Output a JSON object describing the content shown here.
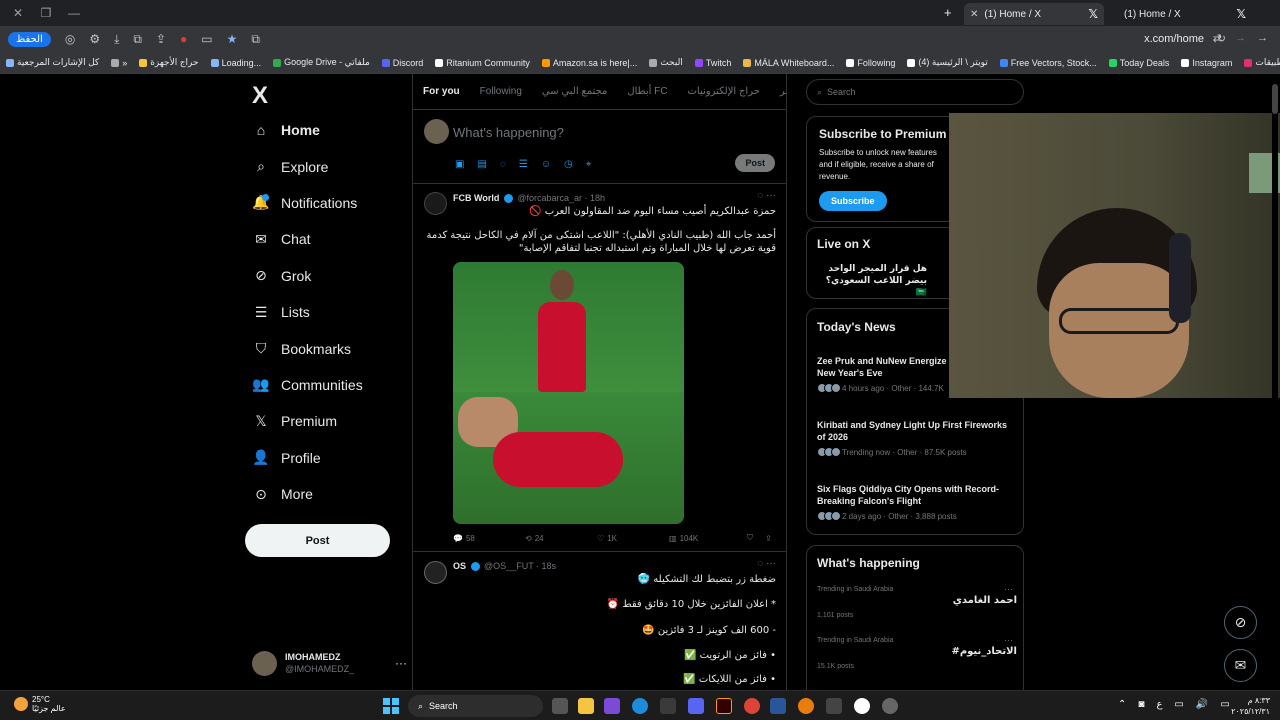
{
  "browser": {
    "tabs": [
      {
        "title": "(1) Home / X"
      },
      {
        "title": "(1) Home / X"
      }
    ],
    "new_tab": "+",
    "url": "x.com/home",
    "profile_label": "الحفظ",
    "bookmarks": [
      "كل الإشارات المرجعية",
      "»",
      "حراج الأجهزة",
      "Loading...",
      "Google Drive - ملفاتي",
      "Discord",
      "Ritanium Community",
      "Amazon.sa is here|...",
      "البحث",
      "Twitch",
      "MÁLA Whiteboard...",
      "Following",
      "(4) تويتر \\ الرئيسية",
      "Free Vectors, Stock...",
      "Today Deals",
      "Instagram",
      "التطبيقات"
    ]
  },
  "sidebar": {
    "logo": "X",
    "items": [
      {
        "label": "Home",
        "icon": "home-icon"
      },
      {
        "label": "Explore",
        "icon": "search-icon"
      },
      {
        "label": "Notifications",
        "icon": "bell-icon"
      },
      {
        "label": "Chat",
        "icon": "mail-icon"
      },
      {
        "label": "Grok",
        "icon": "grok-icon"
      },
      {
        "label": "Lists",
        "icon": "list-icon"
      },
      {
        "label": "Bookmarks",
        "icon": "bookmark-icon"
      },
      {
        "label": "Communities",
        "icon": "people-icon"
      },
      {
        "label": "Premium",
        "icon": "x-icon"
      },
      {
        "label": "Profile",
        "icon": "person-icon"
      },
      {
        "label": "More",
        "icon": "more-circle-icon"
      }
    ],
    "post_label": "Post",
    "account": {
      "name": "IMOHAMEDZ",
      "handle": "@IMOHAMEDZ_",
      "more": "···"
    }
  },
  "feed": {
    "tabs": [
      "For you",
      "Following",
      "مجتمع البي سي",
      "أبطال FC",
      "حراج الإلكترونيات",
      "أساطير"
    ],
    "compose_placeholder": "What's happening?",
    "compose_post": "Post",
    "tweets": [
      {
        "name": "FCB World",
        "handle": "@forcabarca_ar · 18h",
        "lines": [
          "حمزة عبدالكريم أصيب مساء اليوم ضد المقاولون العرب 🚫",
          "أحمد جاب الله (طبيب النادي الأهلي): \"اللاعب اشتكى من آلام في الكاحل نتيجة كدمة",
          "قوية تعرض لها خلال المباراة وتم استبداله تجنبا لتفاقم الإصابة\""
        ],
        "replies": "58",
        "reposts": "24",
        "likes": "1K",
        "views": "104K"
      },
      {
        "name": "OS",
        "handle": "@OS__FUT · 18s",
        "lines": [
          "ضغطة زر بتضبط لك التشكيله 🥶",
          "* اعلان الفائزين خلال 10 دقائق فقط ⏰",
          "- 600 الف كوينز لـ 3 فائزين 🤩",
          "• فائز من الرتويت ✅",
          "• فائز من اللايكات ✅"
        ]
      }
    ]
  },
  "right": {
    "search_placeholder": "Search",
    "premium": {
      "title": "Subscribe to Premium",
      "text": "Subscribe to unlock new features and if eligible, receive a share of revenue.",
      "button": "Subscribe"
    },
    "live": {
      "title": "Live on X",
      "item": "هل قرار الميجر الواحد بيضر اللاعب السعودي؟ 🇸🇦"
    },
    "news": {
      "title": "Today's News",
      "items": [
        {
          "title": "Zee Pruk and NuNew Energize CentralWorld's New Year's Eve",
          "meta": "4 hours ago · Other · 144.7K"
        },
        {
          "title": "Kiribati and Sydney Light Up First Fireworks of 2026",
          "meta": "Trending now · Other · 87.5K posts"
        },
        {
          "title": "Six Flags Qiddiya City Opens with Record-Breaking Falcon's Flight",
          "meta": "2 days ago · Other · 3,888 posts"
        }
      ]
    },
    "happening": {
      "title": "What's happening",
      "trends": [
        {
          "location": "Trending in Saudi Arabia",
          "topic": "احمد الغامدي",
          "posts": "1,101 posts"
        },
        {
          "location": "Trending in Saudi Arabia",
          "topic": "#الاتحاد_نيوم",
          "posts": "15.1K posts"
        }
      ]
    }
  },
  "taskbar": {
    "temp": "25°C",
    "weather_text": "عالم جزئيًا",
    "search": "Search",
    "time": "٨:٣٣ م",
    "date": "٢٠٢٥/١٢/٣١",
    "lang": "ع"
  }
}
